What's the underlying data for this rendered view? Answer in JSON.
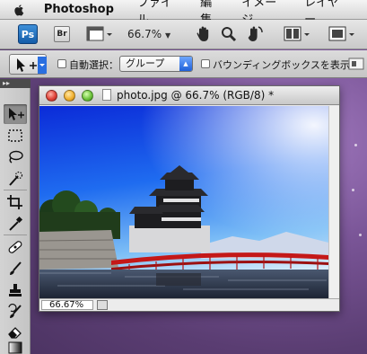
{
  "menubar": {
    "app_name": "Photoshop",
    "items": [
      "ファイル",
      "編集",
      "イメージ",
      "レイヤー"
    ]
  },
  "appbar": {
    "ps_label": "Ps",
    "br_label": "Br",
    "zoom": "66.7%"
  },
  "options": {
    "auto_select_label": "自動選択：",
    "auto_select_value": "グループ",
    "bbox_label": "バウンディングボックスを表示"
  },
  "document": {
    "title": "photo.jpg @ 66.7% (RGB/8) *",
    "zoom_field": "66.67%"
  },
  "icons": [
    "apple-icon",
    "hand-icon",
    "zoom-icon",
    "rotate-view-icon",
    "arrange-documents-icon",
    "screen-mode-icon",
    "move-tool-icon",
    "marquee-icon",
    "lasso-icon",
    "quick-select-icon",
    "crop-icon",
    "eyedropper-icon",
    "healing-brush-icon",
    "brush-icon",
    "clone-stamp-icon",
    "history-brush-icon",
    "eraser-icon",
    "gradient-icon"
  ],
  "colors": {
    "photoshop_blue": "#1f6cc4",
    "select_accent": "#1f60d8"
  }
}
